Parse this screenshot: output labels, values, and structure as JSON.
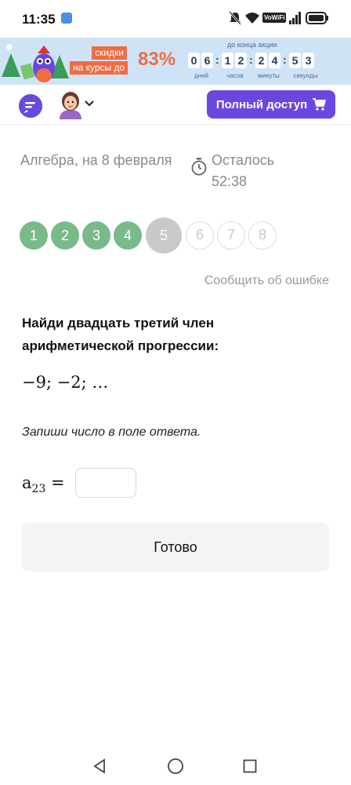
{
  "status_bar": {
    "time": "11:35",
    "volte_label": "VoWiFi",
    "battery_icon": "battery-icon",
    "signal_icon": "signal-icon",
    "wifi_icon": "wifi-icon",
    "mute_icon": "bell-off-icon"
  },
  "banner": {
    "tag_top": "скидки",
    "tag_bottom": "на курсы до",
    "discount": "83%",
    "until_label": "до конца акции",
    "countdown": {
      "days": [
        "0",
        "6"
      ],
      "hours": [
        "1",
        "2"
      ],
      "minutes": [
        "2",
        "4"
      ],
      "seconds": [
        "5",
        "3"
      ]
    },
    "units": {
      "days": "дней",
      "hours": "часов",
      "minutes": "минуты",
      "seconds": "секунды"
    }
  },
  "header": {
    "full_access_label": "Полный доступ"
  },
  "test": {
    "title": "Алгебра, на 8 февраля",
    "timer_label": "Осталось",
    "timer_value": "52:38"
  },
  "progress": {
    "questions": [
      "1",
      "2",
      "3",
      "4",
      "5",
      "6",
      "7",
      "8"
    ],
    "done": 4,
    "current": 5
  },
  "report_label": "Сообщить об ошибке",
  "task": {
    "question_line1": "Найди двадцать третий член",
    "question_line2": "арифметической прогрессии:",
    "sequence": "−9; −2; …",
    "hint": "Запиши число в поле ответа.",
    "answer_var": "a",
    "answer_sub": "23",
    "answer_eq": "=",
    "answer_value": "",
    "answer_placeholder": ""
  },
  "done_label": "Готово",
  "colors": {
    "accent": "#6a48e0",
    "done": "#79b98a",
    "current": "#c9c9c9",
    "promo": "#ef6c44"
  }
}
